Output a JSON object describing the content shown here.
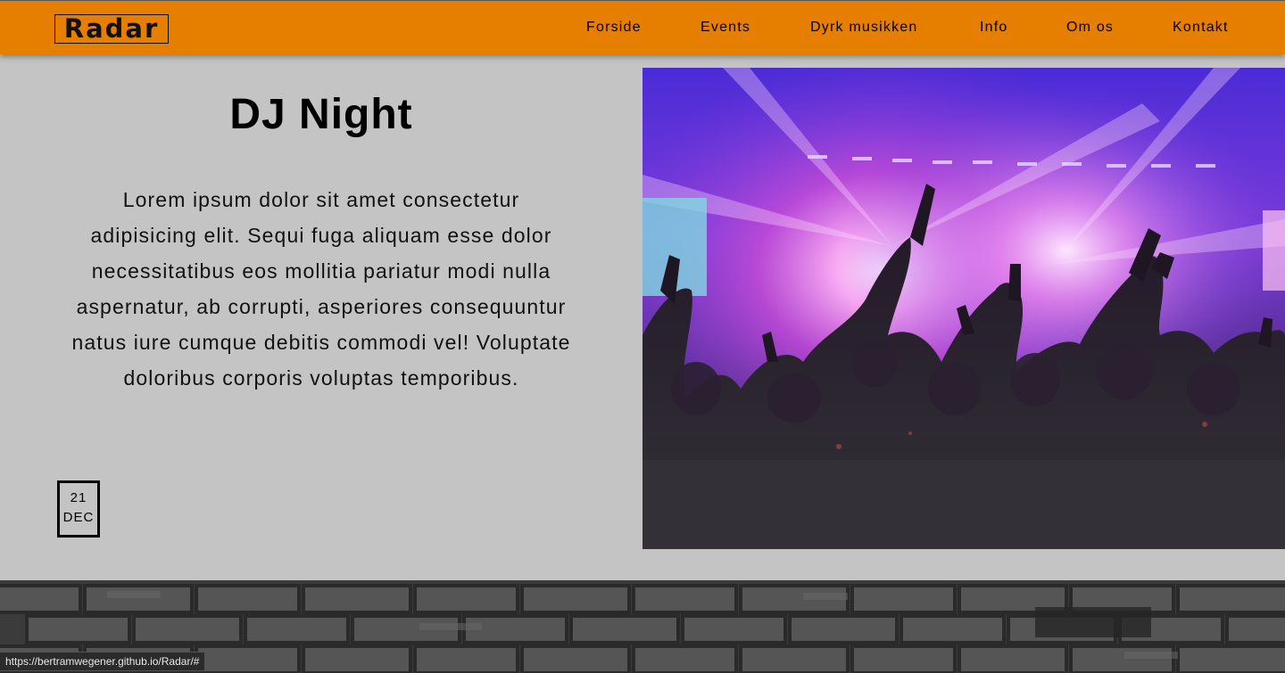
{
  "header": {
    "logo_text": "Radar",
    "brand_color": "#e67e00",
    "nav": [
      {
        "label": "Forside"
      },
      {
        "label": "Events"
      },
      {
        "label": "Dyrk musikken"
      },
      {
        "label": "Info"
      },
      {
        "label": "Om os"
      },
      {
        "label": "Kontakt"
      }
    ]
  },
  "event": {
    "title": "DJ Night",
    "description": "Lorem ipsum dolor sit amet consectetur adipisicing elit. Sequi fuga aliquam esse dolor necessitatibus eos mollitia pariatur modi nulla aspernatur, ab corrupti, asperiores consequuntur natus iure cumque debitis commodi vel! Voluptate doloribus corporis voluptas temporibus.",
    "date_day": "21",
    "date_month": "DEC",
    "image_icon": "concert-crowd-photo"
  },
  "footer": {
    "background_icon": "brick-wall-texture"
  },
  "status_bar": {
    "url": "https://bertramwegener.github.io/Radar/#"
  }
}
